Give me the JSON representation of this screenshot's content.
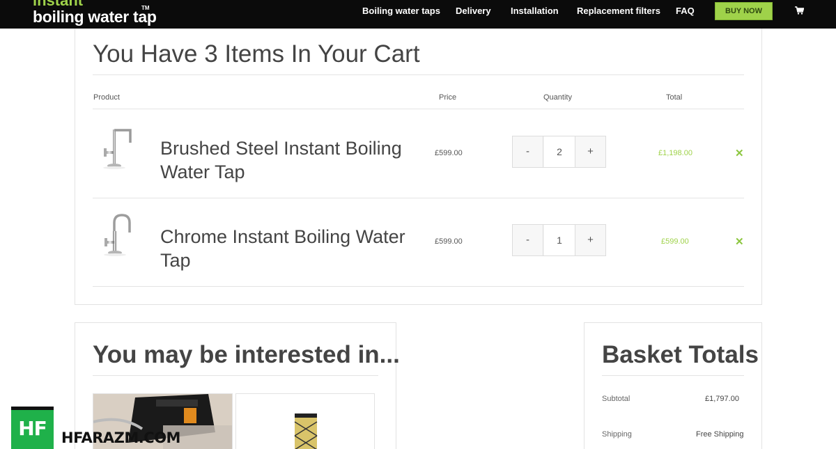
{
  "header": {
    "logo_top": "instant",
    "logo_main": "boiling water tap",
    "logo_tm": "TM",
    "nav": [
      "Boiling water taps",
      "Delivery",
      "Installation",
      "Replacement filters",
      "FAQ"
    ],
    "buy_now": "BUY NOW",
    "cart_icon": "shopping-cart-icon"
  },
  "cart": {
    "title": "You Have 3 Items In Your Cart",
    "columns": {
      "product": "Product",
      "price": "Price",
      "quantity": "Quantity",
      "total": "Total"
    },
    "items": [
      {
        "name": "Brushed Steel Instant Boiling Water Tap",
        "price": "£599.00",
        "qty_minus": "-",
        "quantity": "2",
        "qty_plus": "+",
        "total": "£1,198.00",
        "remove": "✕"
      },
      {
        "name": "Chrome Instant Boiling Water Tap",
        "price": "£599.00",
        "qty_minus": "-",
        "quantity": "1",
        "qty_plus": "+",
        "total": "£599.00",
        "remove": "✕"
      }
    ]
  },
  "interested": {
    "title": "You may be interested in..."
  },
  "basket_totals": {
    "title": "Basket Totals",
    "subtotal_label": "Subtotal",
    "subtotal_value": "£1,797.00",
    "shipping_label": "Shipping",
    "shipping_value": "Free Shipping"
  },
  "watermark": {
    "badge": "HF",
    "domain": "HFARAZM.COM"
  },
  "colors": {
    "accent": "#9fd24a",
    "header_bg": "#0b0b0b",
    "remove": "#8cc63f"
  }
}
